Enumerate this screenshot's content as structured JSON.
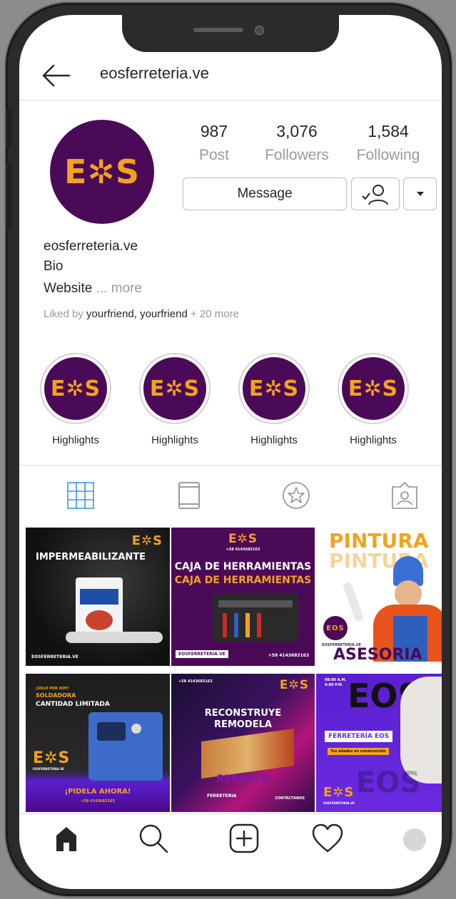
{
  "header": {
    "username": "eosferreteria.ve"
  },
  "profile": {
    "logo_text": "E✲S",
    "stats": [
      {
        "value": "987",
        "label": "Post"
      },
      {
        "value": "3,076",
        "label": "Followers"
      },
      {
        "value": "1,584",
        "label": "Following"
      }
    ],
    "message_label": "Message",
    "name": "eosferreteria.ve",
    "bio": "Bio",
    "website": "Website",
    "more": "... more",
    "liked_prefix": "Liked by",
    "liked_users": "yourfriend, yourfriend",
    "liked_suffix": "+ 20 more"
  },
  "highlights": [
    {
      "label": "Highlights",
      "logo": "E✲S"
    },
    {
      "label": "Highlights",
      "logo": "E✲S"
    },
    {
      "label": "Highlights",
      "logo": "E✲S"
    },
    {
      "label": "Highlights",
      "logo": "E✲S"
    }
  ],
  "tabs": [
    "grid-icon",
    "reels-icon",
    "star-icon",
    "tagged-icon"
  ],
  "posts": [
    {
      "logo": "E✲S",
      "title": "IMPERMEABILIZANTE",
      "footer": "EOSFERRETERIA.VE"
    },
    {
      "logo": "E✲S",
      "phone": "+58 4143683163",
      "title1": "CAJA DE HERRAMIENTAS",
      "title2": "CAJA DE HERRAMIENTAS",
      "footer": "EOSFERRETERIA.VE",
      "phone2": "+58 4143683163"
    },
    {
      "title1": "PINTURA",
      "title2": "PINTURA",
      "badge": "EOS",
      "footer": "EOSFERRETERIA.VE",
      "title3": "ASESORIA"
    },
    {
      "top": "¡SOLO POR HOY!",
      "sub": "SOLDADORA",
      "title": "CANTIDAD LIMITADA",
      "logo": "E✲S",
      "site": "EOSFERRETERIA.VE",
      "cta": "¡PIDELA AHORA!",
      "phone": "+58 4143683163"
    },
    {
      "phone": "+58 4143683163",
      "logo": "E✲S",
      "title1": "RECONSTRUYE",
      "title2": "REMODELA",
      "title3": "RENUEVA",
      "footer": "FERRETERIA",
      "footer2": "CONTÁCTANOS"
    },
    {
      "hours1": "08:00 A.M.",
      "hours2": "0:00 P.M.",
      "big": "EOS",
      "banner": "FERRETERÍA EOS",
      "tag": "Tus aliados en construcción",
      "logo": "E✲S",
      "site": "EOSFERRETERIA.VE",
      "ghost": "EOS"
    }
  ],
  "colors": {
    "brand_purple": "#4b0a58",
    "brand_orange": "#f2a31c",
    "accent_blue": "#3897f0"
  }
}
